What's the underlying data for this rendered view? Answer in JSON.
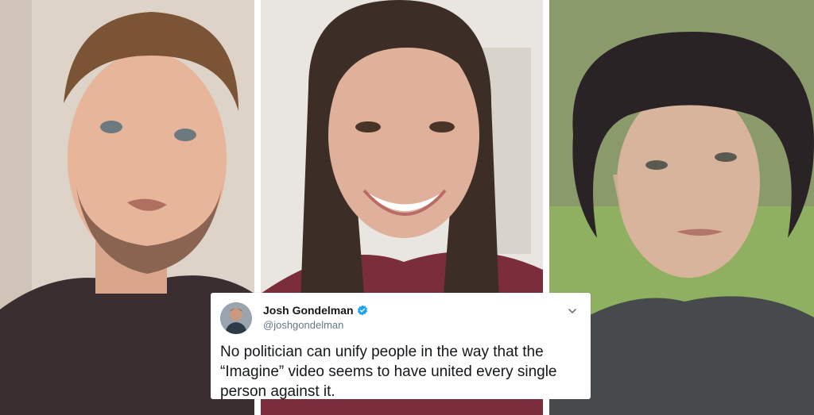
{
  "colors": {
    "tweet_text": "#14171a",
    "tweet_handle": "#657786",
    "verified_badge": "#1da1f2"
  },
  "panels": [
    {
      "name": "photo-man-stubble",
      "icon": "person-video-still"
    },
    {
      "name": "photo-woman-smiling",
      "icon": "person-video-still"
    },
    {
      "name": "photo-woman-hat",
      "icon": "person-video-still"
    }
  ],
  "tweet": {
    "author_name": "Josh Gondelman",
    "author_handle": "@joshgondelman",
    "verified_icon": "verified-badge-icon",
    "menu_icon": "chevron-down-icon",
    "text": "No politician can unify people in the way that the\n“Imagine” video seems to have united every single\nperson against it."
  }
}
